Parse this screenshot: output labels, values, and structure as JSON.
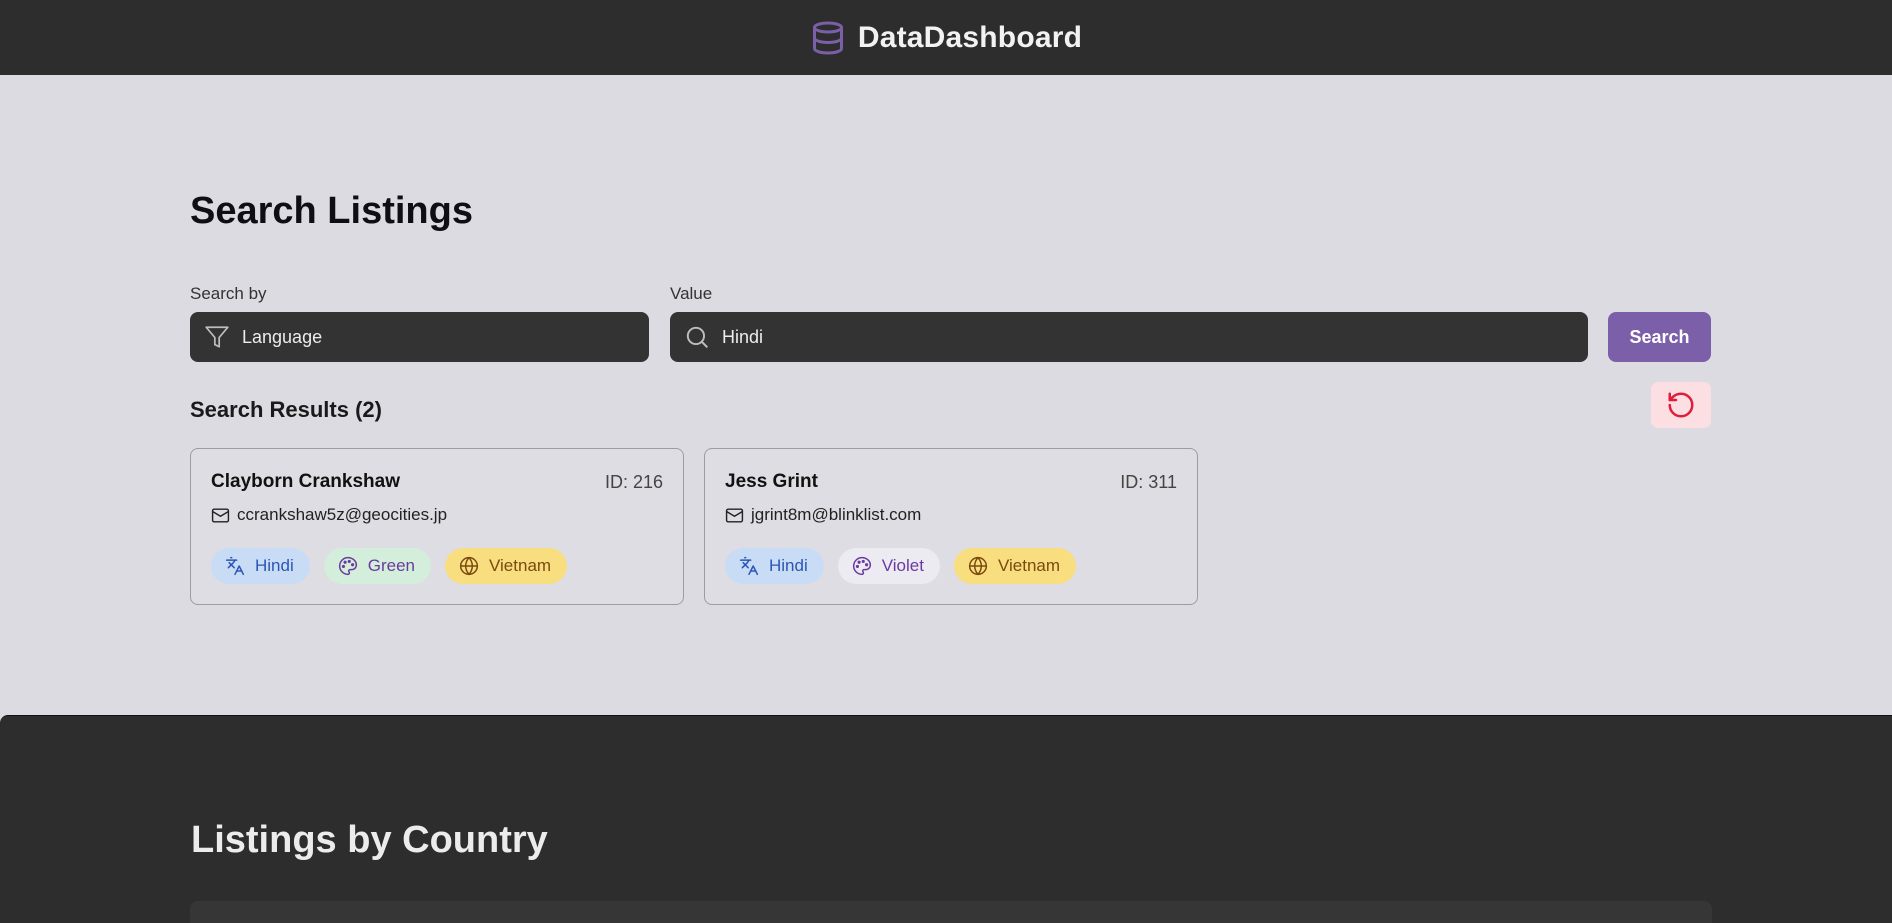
{
  "app": {
    "title": "DataDashboard"
  },
  "search": {
    "title": "Search Listings",
    "search_by_label": "Search by",
    "search_by_value": "Language",
    "value_label": "Value",
    "value_value": "Hindi",
    "search_button": "Search",
    "results_title": "Search Results (2)"
  },
  "results": [
    {
      "name": "Clayborn Crankshaw",
      "id": "ID: 216",
      "email": "ccrankshaw5z@geocities.jp",
      "language": "Hindi",
      "color": "Green",
      "country": "Vietnam"
    },
    {
      "name": "Jess Grint",
      "id": "ID: 311",
      "email": "jgrint8m@blinklist.com",
      "language": "Hindi",
      "color": "Violet",
      "country": "Vietnam"
    }
  ],
  "bottom": {
    "title": "Listings by Country"
  },
  "icons": {
    "brand": "database-icon",
    "search_by": "filter-icon",
    "value": "search-icon",
    "reset": "reset-icon",
    "email": "mail-icon",
    "language": "translate-icon",
    "color": "palette-icon",
    "country": "globe-icon"
  },
  "colors": {
    "accent": "#7b5fa8",
    "topbar": "#2d2d2d",
    "background": "#dcdbe1",
    "reset_bg": "#fbdfe2",
    "reset_icon": "#e01e3c"
  }
}
